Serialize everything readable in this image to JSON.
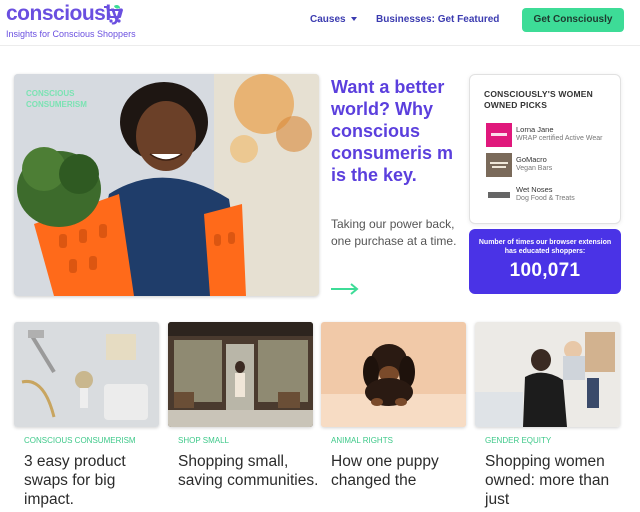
{
  "header": {
    "logo": "consciously",
    "tagline": "Insights for Conscious Shoppers",
    "nav": {
      "causes": "Causes",
      "business": "Businesses: Get Featured"
    },
    "cta": "Get Consciously"
  },
  "hero": {
    "tag": "CONSCIOUS CONSUMERISM",
    "title": "Want a better world? Why conscious consumeris m is the key.",
    "subtitle": "Taking our power back, one purchase at a time."
  },
  "picks": {
    "title": "CONSCIOUSLY'S WOMEN OWNED PICKS",
    "items": [
      {
        "name": "Lorna Jane",
        "desc": "WRAP certified Active Wear",
        "icon": "lorna-jane-logo"
      },
      {
        "name": "GoMacro",
        "desc": "Vegan Bars",
        "icon": "gomacro-logo"
      },
      {
        "name": "Wet Noses",
        "desc": "Dog Food & Treats",
        "icon": "wet-noses-logo"
      }
    ]
  },
  "counter": {
    "label": "Number of times our browser extension has educated shoppers:",
    "value": "100,071"
  },
  "articles": [
    {
      "category": "CONSCIOUS CONSUMERISM",
      "title": "3 easy product swaps for big impact."
    },
    {
      "category": "SHOP SMALL",
      "title": "Shopping small, saving communities."
    },
    {
      "category": "ANIMAL RIGHTS",
      "title": "How one puppy changed the"
    },
    {
      "category": "GENDER EQUITY",
      "title": "Shopping women owned: more than just"
    }
  ],
  "colors": {
    "brand": "#5b3fdd",
    "accent_green": "#3ddc97",
    "counter_bg": "#4a33e6"
  }
}
